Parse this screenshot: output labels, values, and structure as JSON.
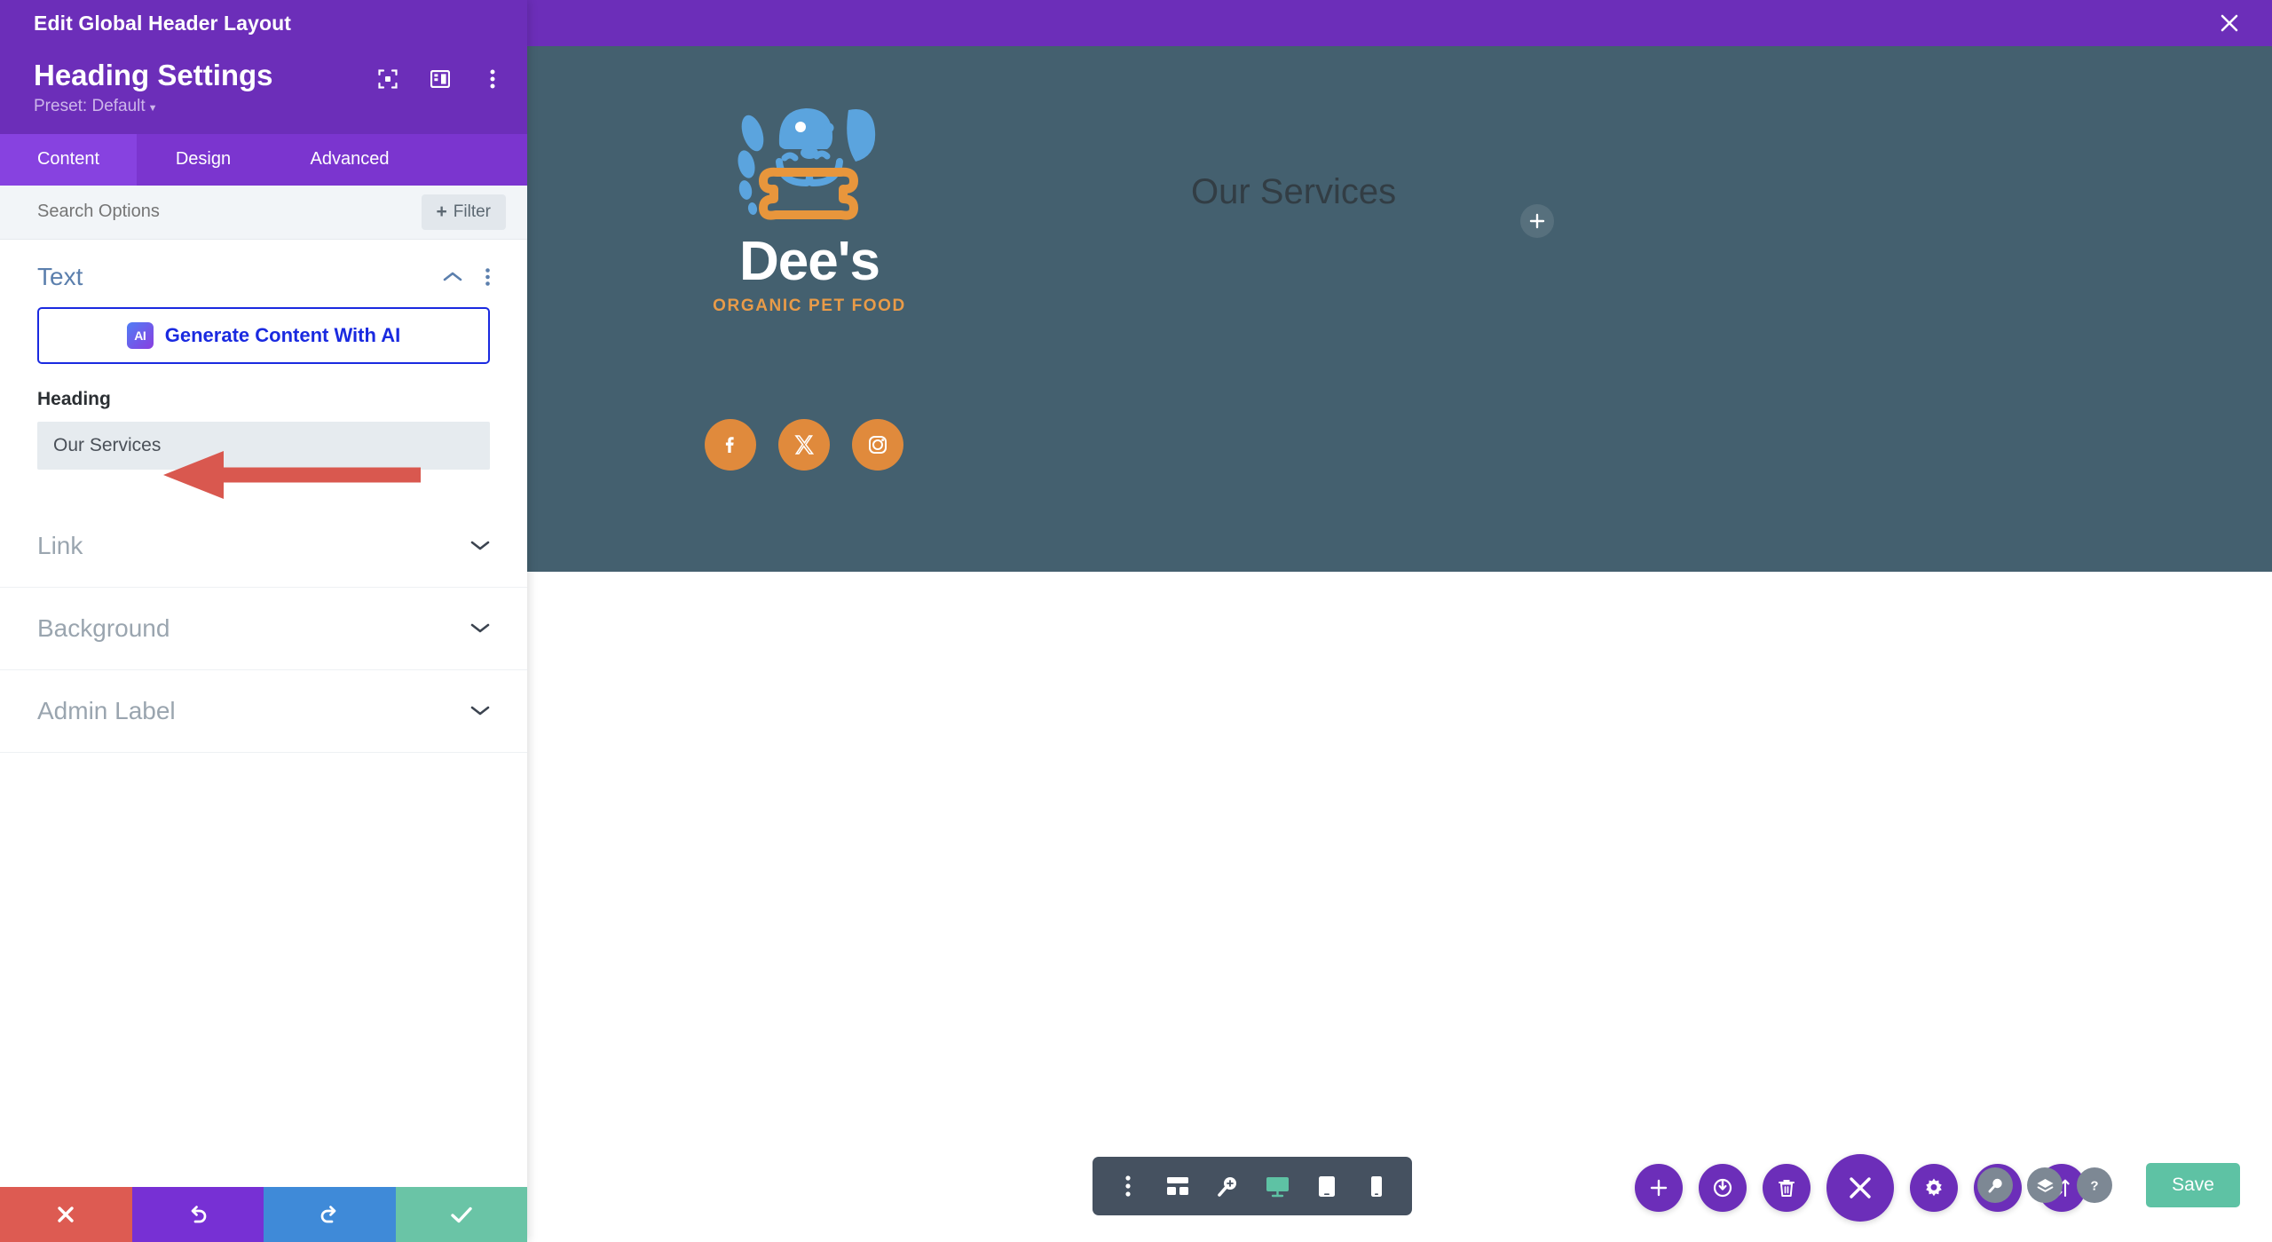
{
  "window": {
    "title": "Edit Global Header Layout",
    "close_icon": "close-icon"
  },
  "settings": {
    "module_title": "Heading Settings",
    "preset_label": "Preset: Default",
    "header_icons": [
      {
        "name": "focus-target-icon"
      },
      {
        "name": "panel-layout-icon"
      },
      {
        "name": "more-options-icon"
      }
    ],
    "tabs": [
      {
        "label": "Content",
        "active": true
      },
      {
        "label": "Design",
        "active": false
      },
      {
        "label": "Advanced",
        "active": false
      }
    ],
    "search": {
      "placeholder": "Search Options",
      "value": ""
    },
    "filter_button": {
      "label": "Filter",
      "plus": "+"
    },
    "text_section": {
      "title": "Text",
      "collapse_icon": "chevron-up-icon",
      "more_icon": "more-options-icon",
      "ai_button": {
        "label": "Generate Content With AI",
        "badge": "AI"
      },
      "heading_field": {
        "label": "Heading",
        "value": "Our Services",
        "placeholder": ""
      }
    },
    "collapsed_sections": [
      {
        "title": "Link",
        "chevron": "chevron-down-icon"
      },
      {
        "title": "Background",
        "chevron": "chevron-down-icon"
      },
      {
        "title": "Admin Label",
        "chevron": "chevron-down-icon"
      }
    ],
    "footer_buttons": [
      {
        "name": "discard-button",
        "icon": "close-icon",
        "color": "#dd5b52"
      },
      {
        "name": "undo-button",
        "icon": "undo-icon",
        "color": "#7730d4"
      },
      {
        "name": "redo-button",
        "icon": "redo-icon",
        "color": "#3f8ad8"
      },
      {
        "name": "save-changes-button",
        "icon": "check-icon",
        "color": "#6ac4a6"
      }
    ]
  },
  "canvas": {
    "background_color": "#44606F",
    "logo": {
      "name": "Dee's",
      "tagline": "ORGANIC PET FOOD",
      "mark": "dog-head-with-bone-logo"
    },
    "social_icons": [
      {
        "name": "facebook-icon",
        "glyph": "f"
      },
      {
        "name": "x-twitter-icon",
        "glyph": "X"
      },
      {
        "name": "instagram-icon",
        "glyph": "camera"
      }
    ],
    "heading": "Our Services",
    "add_module_button": "+"
  },
  "toolbar": {
    "mode_icons": [
      {
        "name": "more-options-icon"
      },
      {
        "name": "wireframe-view-icon"
      },
      {
        "name": "zoom-out-view-icon"
      },
      {
        "name": "desktop-view-icon",
        "active": true
      },
      {
        "name": "tablet-view-icon"
      },
      {
        "name": "phone-view-icon"
      }
    ],
    "round_buttons": [
      {
        "name": "add-section-button",
        "icon": "plus-icon"
      },
      {
        "name": "toggle-builder-button",
        "icon": "power-icon"
      },
      {
        "name": "clear-layout-button",
        "icon": "trash-icon"
      },
      {
        "name": "close-builder-button",
        "icon": "close-icon",
        "big": true
      },
      {
        "name": "settings-button",
        "icon": "gear-icon"
      },
      {
        "name": "history-button",
        "icon": "clock-icon"
      },
      {
        "name": "portability-button",
        "icon": "sort-arrows-icon"
      }
    ],
    "util_buttons": [
      {
        "name": "search-button",
        "icon": "magnifier-icon"
      },
      {
        "name": "layers-button",
        "icon": "layers-icon"
      },
      {
        "name": "help-button",
        "icon": "question-icon"
      }
    ],
    "save_label": "Save"
  },
  "annotation": {
    "arrow_color": "#d9584f",
    "points_at": "heading-input"
  }
}
